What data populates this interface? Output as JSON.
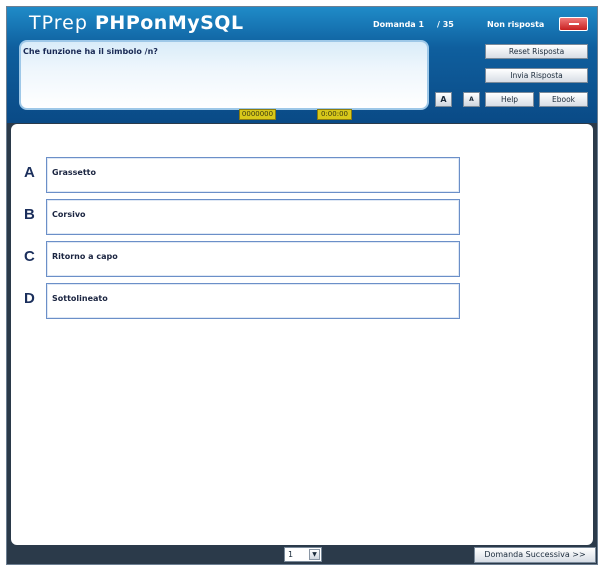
{
  "app": {
    "logo_prefix": "TPrep",
    "logo_name": "PHPonMySQL"
  },
  "header": {
    "question_number": "Domanda 1",
    "question_total": "/ 35",
    "status": "Non risposta"
  },
  "question": {
    "text": "Che funzione ha il simbolo /n?"
  },
  "buttons": {
    "reset": "Reset Risposta",
    "send": "Invia Risposta",
    "help": "Help",
    "ebook": "Ebook",
    "font_larger": "A",
    "font_smaller": "A"
  },
  "timers": {
    "left": "0000000",
    "right": "0:00:00"
  },
  "answers": [
    {
      "letter": "A",
      "text": "Grassetto"
    },
    {
      "letter": "B",
      "text": "Corsivo"
    },
    {
      "letter": "C",
      "text": "Ritorno a capo"
    },
    {
      "letter": "D",
      "text": "Sottolineato"
    }
  ],
  "footer": {
    "page_select_value": "1",
    "page_select_arrow": "▼",
    "next_button": "Domanda Successiva >>"
  },
  "colors": {
    "header_top": "#1f8bc8",
    "header_bottom": "#0a4a86",
    "frame": "#2b3a4a",
    "timer": "#d8c81a",
    "answer_border": "#6b8fc8",
    "close_button": "#c82020"
  }
}
